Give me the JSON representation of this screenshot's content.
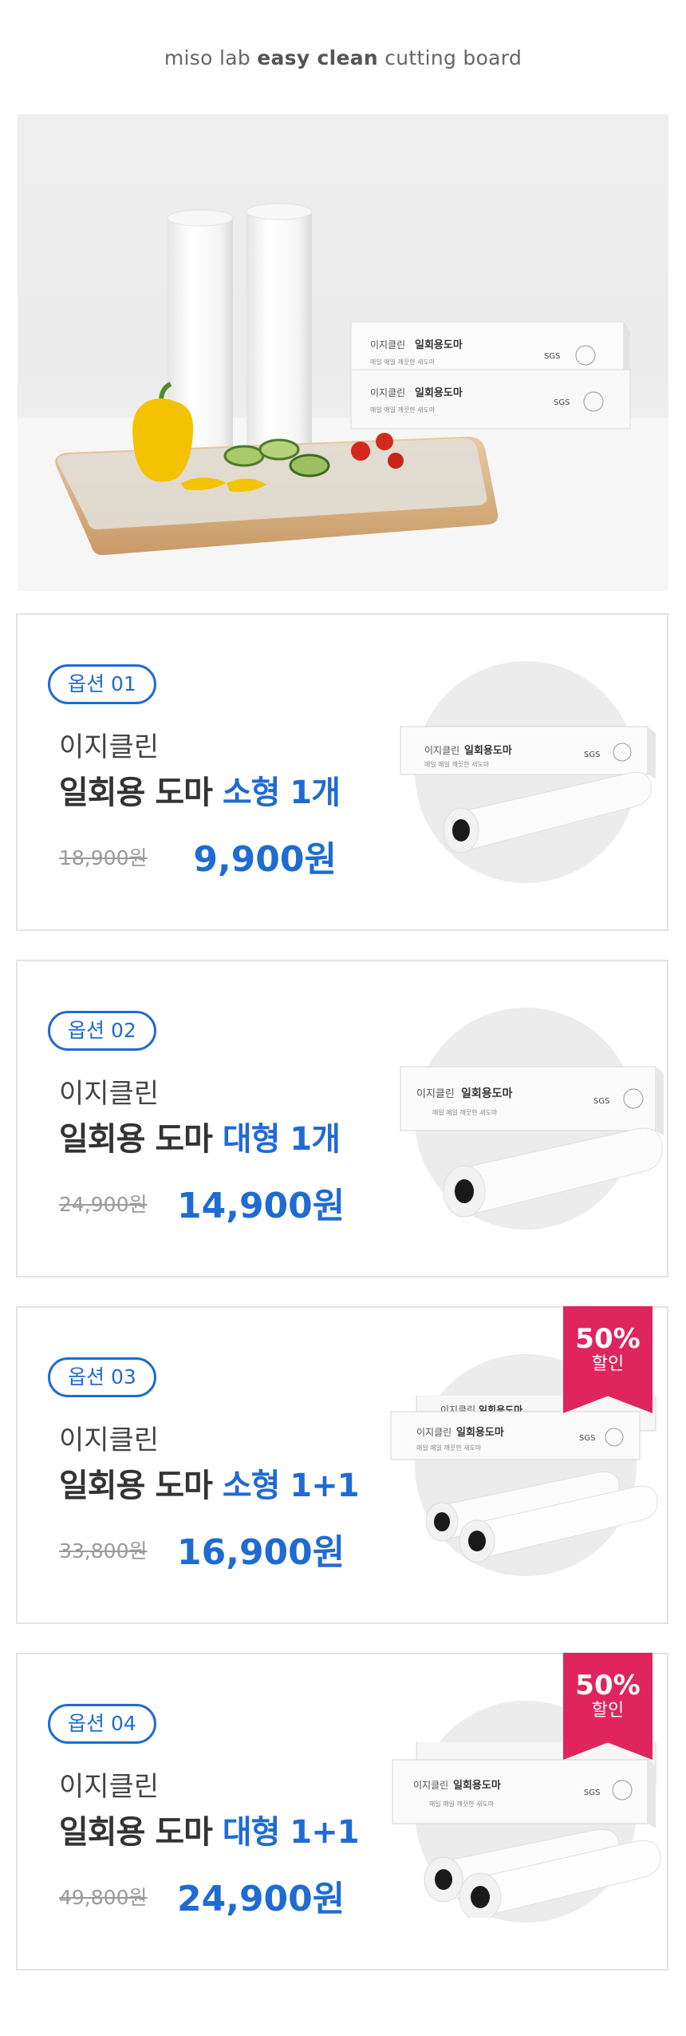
{
  "header": {
    "part1": "miso lab ",
    "part2": "easy clean",
    "part3": " cutting board"
  },
  "hero": {
    "box_brand": "이지클린",
    "box_name": "일회용도마",
    "box_sub": "매일 매일 깨끗한 새도마",
    "box_cert": "SGS"
  },
  "product_box": {
    "brand": "이지클린",
    "name": "일회용도마",
    "sub": "매일 매일 깨끗한 새도마",
    "cert": "SGS"
  },
  "options": [
    {
      "label": "옵션 01",
      "brand": "이지클린",
      "title_main": "일회용 도마 ",
      "title_highlight": "소형 1개",
      "original_price": "18,900원",
      "sale_price": "9,900원"
    },
    {
      "label": "옵션 02",
      "brand": "이지클린",
      "title_main": "일회용 도마 ",
      "title_highlight": "대형 1개",
      "original_price": "24,900원",
      "sale_price": "14,900원"
    },
    {
      "label": "옵션 03",
      "brand": "이지클린",
      "title_main": "일회용 도마 ",
      "title_highlight": "소형 1+1",
      "original_price": "33,800원",
      "sale_price": "16,900원",
      "badge_pct": "50%",
      "badge_label": "할인"
    },
    {
      "label": "옵션 04",
      "brand": "이지클린",
      "title_main": "일회용 도마 ",
      "title_highlight": "대형 1+1",
      "original_price": "49,800원",
      "sale_price": "24,900원",
      "badge_pct": "50%",
      "badge_label": "할인"
    }
  ],
  "colors": {
    "accent_blue": "#1f6bd2",
    "badge_red": "#e0245e"
  }
}
